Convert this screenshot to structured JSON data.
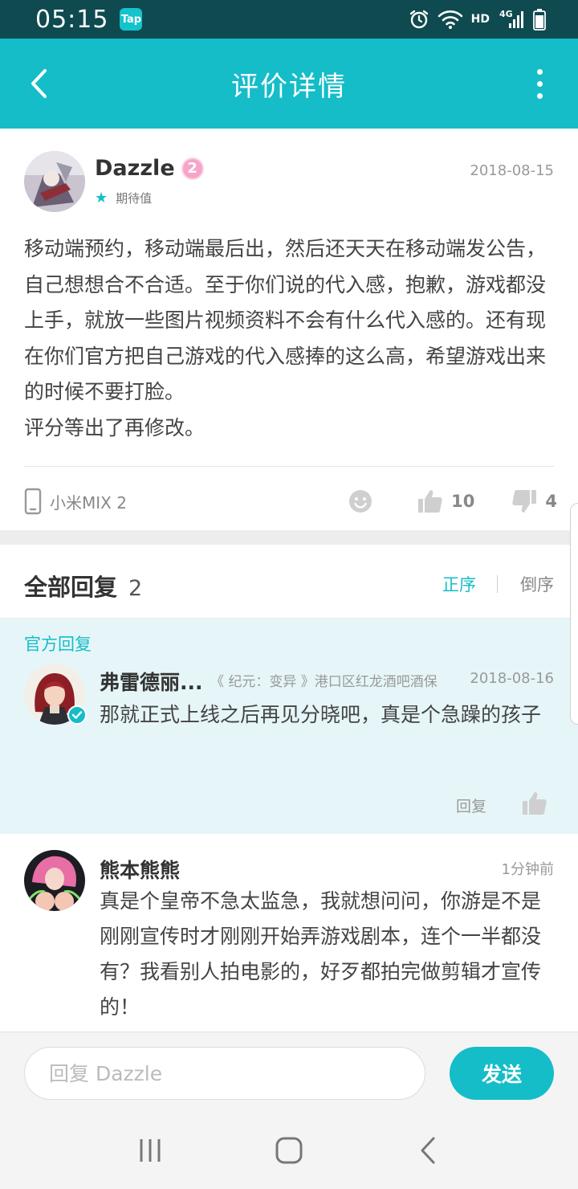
{
  "status_bar": {
    "time": "05:15",
    "tap_badge": "Tap",
    "hd_label": "HD",
    "network_label": "4G",
    "icons": [
      "alarm-icon",
      "wifi-icon",
      "signal-icon",
      "battery-icon"
    ]
  },
  "app_bar": {
    "title": "评价详情",
    "back_icon": "chevron-left-icon",
    "more_icon": "more-vertical-icon"
  },
  "review": {
    "username": "Dazzle",
    "level": "2",
    "expect_label": "期待值",
    "date": "2018-08-15",
    "body_lines": [
      "移动端预约，移动端最后出，然后还天天在移动端发公告，自己想想合不合适。至于你们说的代入感，抱歉，游戏都没上手，就放一些图片视频资料不会有什么代入感的。还有现在你们官方把自己游戏的代入感捧的这么高，希望游戏出来的时候不要打脸。",
      "评分等出了再修改。"
    ],
    "device": "小米MIX 2",
    "likes": "10",
    "dislikes": "4"
  },
  "replies": {
    "title": "全部回复",
    "count": "2",
    "sort_asc": "正序",
    "sort_desc": "倒序",
    "official": {
      "tag": "官方回复",
      "name": "弗雷德丽...",
      "subtitle": "《 纪元：变异 》港口区红龙酒吧酒保",
      "date": "2018-08-16",
      "text": "那就正式上线之后再见分晓吧，真是个急躁的孩子",
      "reply_label": "回复"
    },
    "items": [
      {
        "name": "熊本熊熊",
        "time": "1分钟前",
        "text": "真是个皇帝不急太监急，我就想问问，你游是不是刚刚宣传时才刚刚开始弄游戏剧本，连个一半都没有？我看别人拍电影的，好歹都拍完做剪辑才宣传的！"
      }
    ]
  },
  "input_bar": {
    "placeholder": "回复 Dazzle",
    "send_label": "发送"
  },
  "colors": {
    "accent": "#14bdc8",
    "status_bar": "#0e4a50",
    "official_bg": "#e6f6f8"
  }
}
